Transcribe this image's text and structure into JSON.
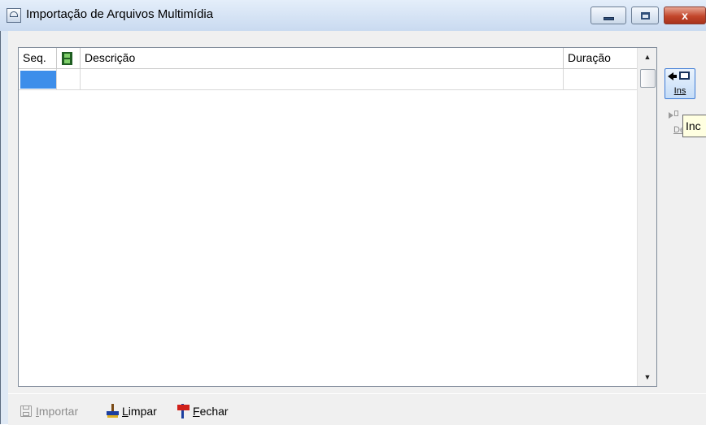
{
  "window": {
    "title": "Importação de Arquivos Multimídia",
    "close_glyph": "x"
  },
  "grid": {
    "columns": [
      {
        "key": "seq",
        "label": "Seq."
      },
      {
        "key": "media",
        "label": "",
        "icon": "film-icon"
      },
      {
        "key": "desc",
        "label": "Descrição"
      },
      {
        "key": "dur",
        "label": "Duração"
      }
    ],
    "rows": [
      {
        "seq": "",
        "media": "",
        "desc": "",
        "dur": "",
        "selected_cell": "seq"
      }
    ]
  },
  "side": {
    "insert_label": "Ins",
    "delete_label": "De",
    "tooltip": "Inc"
  },
  "toolbar": {
    "importar_label": "Importar",
    "importar_enabled": false,
    "limpar_label": "Limpar",
    "fechar_label": "Fechar"
  },
  "colors": {
    "selection": "#3d8eea",
    "close_button": "#c2462b",
    "tooltip_bg": "#ffffe1"
  }
}
